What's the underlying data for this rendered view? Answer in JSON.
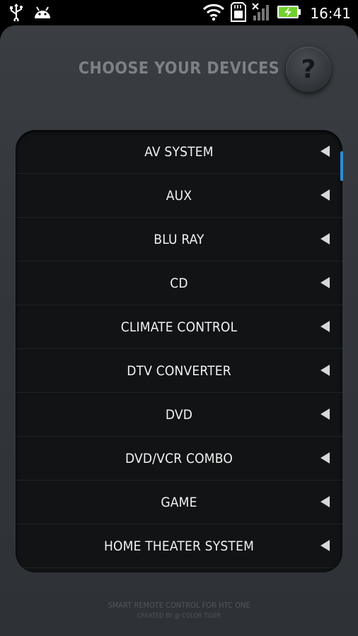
{
  "status_bar": {
    "left_icons": [
      "usb-icon",
      "android-icon"
    ],
    "right_icons": [
      "wifi-icon",
      "sd-card-icon",
      "signal-icon",
      "battery-charging-icon"
    ],
    "time": "16:41"
  },
  "header": {
    "title": "CHOOSE YOUR DEVICES",
    "help_label": "?"
  },
  "devices": [
    "AV SYSTEM",
    "AUX",
    "BLU RAY",
    "CD",
    "CLIMATE CONTROL",
    "DTV CONVERTER",
    "DVD",
    "DVD/VCR COMBO",
    "GAME",
    "HOME THEATER SYSTEM"
  ],
  "footer": {
    "line1": "SMART REMOTE CONTROL FOR HTC ONE",
    "line2": "CREATED BY @ COLOR TIGER"
  },
  "colors": {
    "accent": "#2a8fd6",
    "battery": "#6fd12b"
  }
}
